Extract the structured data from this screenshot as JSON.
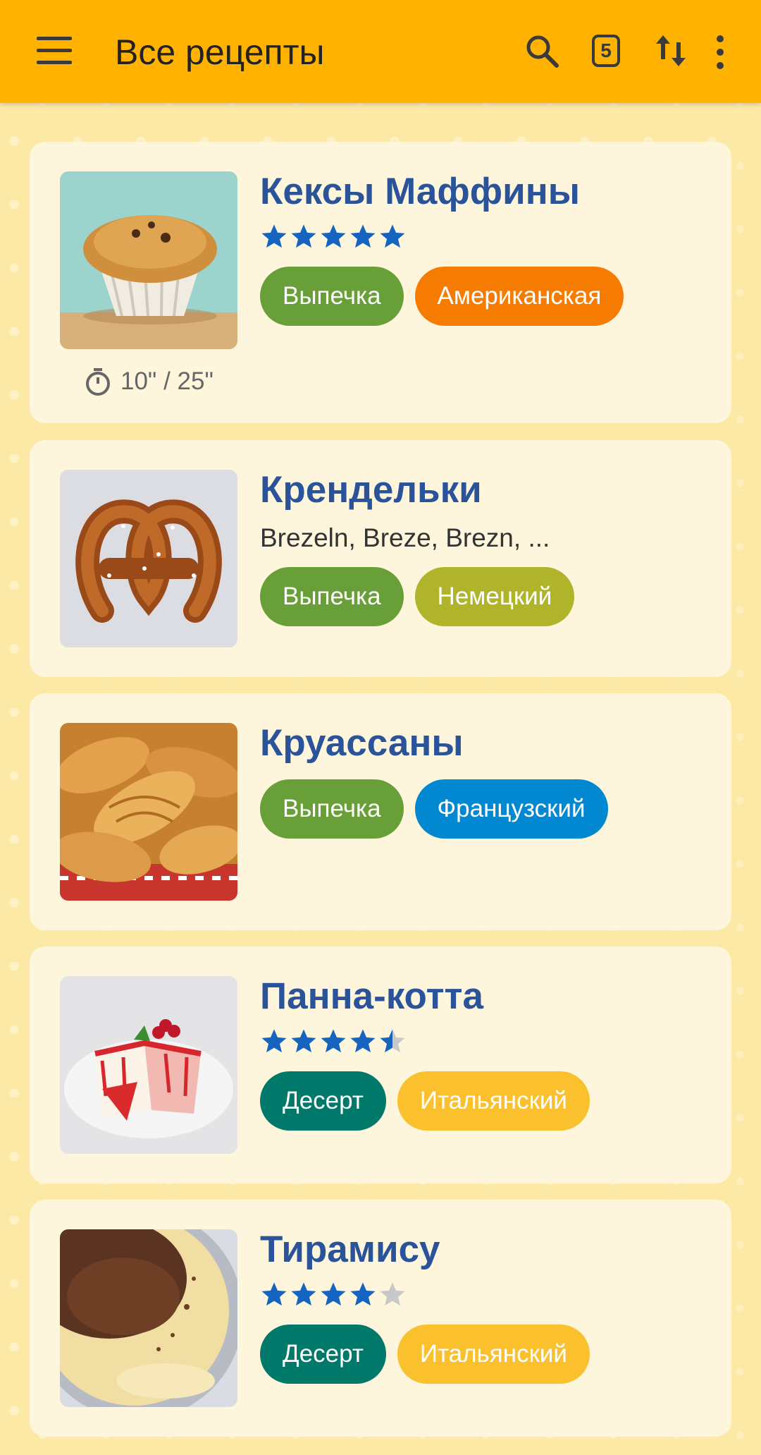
{
  "app_bar": {
    "title": "Все рецепты",
    "menu_icon": "menu-icon",
    "search_icon": "search-icon",
    "count_badge": "5",
    "sort_icon": "sort-icon",
    "more_icon": "more-vert-icon"
  },
  "colors": {
    "app_bar": "#ffb300",
    "card": "#fdf5dc",
    "title": "#2a5399",
    "star": "#1565c0",
    "star_empty": "#c8c8c8",
    "chip_bakery": "#689f38",
    "chip_american": "#f57c00",
    "chip_german": "#afb42b",
    "chip_french": "#0288d1",
    "chip_dessert": "#00796b",
    "chip_italian": "#fbc02d"
  },
  "recipes": [
    {
      "name": "Кексы Маффины",
      "image": "muffin-photo",
      "rating": 5,
      "tags": [
        "Выпечка",
        "Американская"
      ],
      "time": "10\" / 25\""
    },
    {
      "name": "Крендельки",
      "image": "pretzel-photo",
      "subtitle": "Brezeln, Breze, Brezn, ...",
      "tags": [
        "Выпечка",
        "Немецкий"
      ]
    },
    {
      "name": "Круассаны",
      "image": "croissant-photo",
      "tags": [
        "Выпечка",
        "Французский"
      ]
    },
    {
      "name": "Панна-котта",
      "image": "panna-cotta-photo",
      "rating": 4.5,
      "tags": [
        "Десерт",
        "Итальянский"
      ]
    },
    {
      "name": "Тирамису",
      "image": "tiramisu-photo",
      "rating": 4,
      "tags": [
        "Десерт",
        "Итальянский"
      ]
    }
  ]
}
